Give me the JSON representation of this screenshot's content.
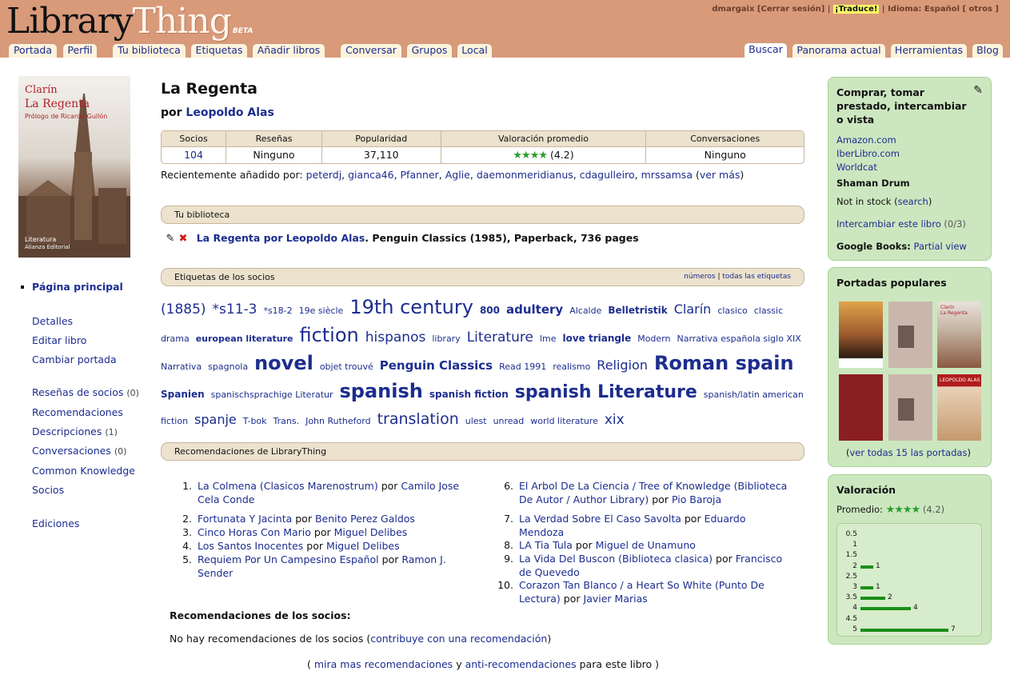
{
  "header": {
    "logo_part1": "Library",
    "logo_part2": "Thing",
    "logo_beta": "BETA",
    "user": "dmargaix",
    "logout": "[Cerrar sesión]",
    "translate": "¡Traduce!",
    "language": "Idioma: Español [ otros ]",
    "tabs_left": [
      "Portada",
      "Perfil",
      "Tu biblioteca",
      "Etiquetas",
      "Añadir libros",
      "Conversar",
      "Grupos",
      "Local"
    ],
    "tabs_right": [
      "Buscar",
      "Panorama actual",
      "Herramientas",
      "Blog"
    ]
  },
  "cover": {
    "author": "Clarín",
    "title": "La Regenta",
    "prologue": "Prólogo de Ricardo Gullón",
    "series": "Literatura",
    "publisher": "Alianza Editorial"
  },
  "leftnav": {
    "main": "Página principal",
    "details": "Detalles",
    "edit": "Editar libro",
    "change_cover": "Cambiar portada",
    "reviews": "Reseñas de socios",
    "reviews_count": "(0)",
    "recommendations": "Recomendaciones",
    "descriptions": "Descripciones",
    "descriptions_count": "(1)",
    "conversations": "Conversaciones",
    "conversations_count": "(0)",
    "common_knowledge": "Common Knowledge",
    "members": "Socios",
    "editions": "Ediciones"
  },
  "book": {
    "title": "La Regenta",
    "by": "por",
    "author": "Leopoldo Alas"
  },
  "stats": {
    "headers": [
      "Socios",
      "Reseñas",
      "Popularidad",
      "Valoración promedio",
      "Conversaciones"
    ],
    "members": "104",
    "reviews": "Ninguno",
    "popularity": "37,110",
    "rating_stars": "★★★★",
    "rating": "(4.2)",
    "conversations": "Ninguno"
  },
  "recent": {
    "label": "Recientemente añadido por:",
    "users": [
      "peterdj",
      "gianca46",
      "Pfanner",
      "Aglie",
      "daemonmeridianus",
      "cdagulleiro",
      "mrssamsa"
    ],
    "more": "ver más"
  },
  "mylibrary": {
    "heading": "Tu biblioteca",
    "entry_link": "La Regenta por Leopoldo Alas",
    "entry_rest": ". Penguin Classics (1985), Paperback, 736 pages"
  },
  "tags": {
    "heading": "Etiquetas de los socios",
    "link_numbers": "números",
    "link_all": "todas las etiquetas",
    "items": [
      {
        "t": "(1885)",
        "s": 17,
        "b": false
      },
      {
        "t": "*s11-3",
        "s": 17,
        "b": false
      },
      {
        "t": "*s18-2",
        "s": 11,
        "b": false
      },
      {
        "t": "19e siècle",
        "s": 11,
        "b": false
      },
      {
        "t": "19th century",
        "s": 24,
        "b": false
      },
      {
        "t": "800",
        "s": 12,
        "b": true
      },
      {
        "t": "adultery",
        "s": 15,
        "b": true
      },
      {
        "t": "Alcalde",
        "s": 11,
        "b": false
      },
      {
        "t": "Belletristik",
        "s": 12,
        "b": true
      },
      {
        "t": "Clarín",
        "s": 16,
        "b": false
      },
      {
        "t": "clasico",
        "s": 11,
        "b": false
      },
      {
        "t": "classic drama",
        "s": 11,
        "b": false
      },
      {
        "t": "european literature",
        "s": 11,
        "b": true
      },
      {
        "t": "fiction",
        "s": 24,
        "b": false
      },
      {
        "t": "hispanos",
        "s": 17,
        "b": false
      },
      {
        "t": "library",
        "s": 11,
        "b": false
      },
      {
        "t": "Literature",
        "s": 17,
        "b": false
      },
      {
        "t": "lme",
        "s": 11,
        "b": false
      },
      {
        "t": "love triangle",
        "s": 12,
        "b": true
      },
      {
        "t": "Modern",
        "s": 11,
        "b": false
      },
      {
        "t": "Narrativa española siglo XIX",
        "s": 11,
        "b": false
      },
      {
        "t": "Narrativa",
        "s": 11,
        "b": false
      },
      {
        "t": "spagnola",
        "s": 11,
        "b": false
      },
      {
        "t": "novel",
        "s": 24,
        "b": true
      },
      {
        "t": "objet trouvé",
        "s": 11,
        "b": false
      },
      {
        "t": "Penguin Classics",
        "s": 15,
        "b": true
      },
      {
        "t": "Read 1991",
        "s": 11,
        "b": false
      },
      {
        "t": "realismo",
        "s": 11,
        "b": false
      },
      {
        "t": "Religion",
        "s": 16,
        "b": false
      },
      {
        "t": "Roman spain",
        "s": 24,
        "b": true
      },
      {
        "t": "Spanien",
        "s": 12,
        "b": true
      },
      {
        "t": "spanischsprachige Literatur",
        "s": 11,
        "b": false
      },
      {
        "t": "spanish",
        "s": 24,
        "b": true
      },
      {
        "t": "spanish fiction",
        "s": 12,
        "b": true
      },
      {
        "t": "spanish Literature",
        "s": 22,
        "b": true
      },
      {
        "t": "spanish/latin american fiction",
        "s": 11,
        "b": false
      },
      {
        "t": "spanje",
        "s": 16,
        "b": false
      },
      {
        "t": "T-bok",
        "s": 11,
        "b": false
      },
      {
        "t": "Trans.",
        "s": 11,
        "b": false
      },
      {
        "t": "John Rutheford",
        "s": 11,
        "b": false
      },
      {
        "t": "translation",
        "s": 19,
        "b": false
      },
      {
        "t": "ulest",
        "s": 11,
        "b": false
      },
      {
        "t": "unread",
        "s": 11,
        "b": false
      },
      {
        "t": "world literature",
        "s": 11,
        "b": false
      },
      {
        "t": "xix",
        "s": 17,
        "b": false
      }
    ]
  },
  "recs": {
    "heading": "Recomendaciones de LibraryThing",
    "by": "por",
    "items": [
      {
        "n": "1.",
        "l1": "La Colmena (Clasicos Marenostrum)",
        "l2": "",
        "a1": "Camilo Jose",
        "a2": "Cela Conde"
      },
      {
        "n": "2.",
        "l1": "Fortunata Y Jacinta",
        "l2": "",
        "a1": "Benito Perez Galdos",
        "a2": ""
      },
      {
        "n": "3.",
        "l1": "Cinco Horas Con Mario",
        "l2": "",
        "a1": "Miguel Delibes",
        "a2": ""
      },
      {
        "n": "4.",
        "l1": "Los Santos Inocentes",
        "l2": "",
        "a1": "Miguel Delibes",
        "a2": ""
      },
      {
        "n": "5.",
        "l1": "Requiem Por Un Campesino Español",
        "l2": "",
        "a1": "Ramon J.",
        "a2": "Sender"
      },
      {
        "n": "6.",
        "l1": "El Arbol De La Ciencia / Tree of Knowledge (Biblioteca",
        "l2": "De Autor / Author Library)",
        "a1": "Pio Baroja",
        "a2": ""
      },
      {
        "n": "7.",
        "l1": "La Verdad Sobre El Caso Savolta",
        "l2": "",
        "a1": "Eduardo",
        "a2": "Mendoza"
      },
      {
        "n": "8.",
        "l1": "LA Tia Tula",
        "l2": "",
        "a1": "Miguel de Unamuno",
        "a2": ""
      },
      {
        "n": "9.",
        "l1": "La Vida Del Buscon (Biblioteca clasica)",
        "l2": "",
        "a1": "Francisco",
        "a2": "de Quevedo"
      },
      {
        "n": "10.",
        "l1": "Corazon Tan Blanco / a Heart So White (Punto De",
        "l2": "Lectura)",
        "a1": "Javier Marias",
        "a2": ""
      }
    ],
    "member_heading": "Recomendaciones de los socios:",
    "none_text": "No hay recomendaciones de los socios (",
    "contribute": "contribuye con una recomendación",
    "close_paren": ")",
    "more_open": "(",
    "more_link": "mira mas recomendaciones",
    "and": "y",
    "anti_link": "anti-recomendaciones",
    "more_tail": "para este libro )"
  },
  "buy": {
    "heading": "Comprar, tomar prestado, intercambiar o vista",
    "amazon": "Amazon.com",
    "iberlibro": "IberLibro.com",
    "worldcat": "Worldcat",
    "shaman": "Shaman Drum",
    "stock": "Not in stock (",
    "search": "search",
    "stock_close": ")",
    "swap": "Intercambiar este libro",
    "swap_count": "(0/3)",
    "google_label": "Google Books:",
    "google_link": "Partial view"
  },
  "covers": {
    "heading": "Portadas populares",
    "see_all": "ver todas 15 las portadas",
    "thumb_texts": [
      "",
      "",
      "Clarín",
      "La Regenta",
      "",
      "LEOPOLDO ALAS"
    ]
  },
  "rating": {
    "heading": "Valoración",
    "avg_label": "Promedio:",
    "stars": "★★★★",
    "avg": "(4.2)"
  },
  "chart_data": {
    "type": "bar",
    "categories": [
      "0.5",
      "1",
      "1.5",
      "2",
      "2.5",
      "3",
      "3.5",
      "4",
      "4.5",
      "5"
    ],
    "values": [
      0,
      0,
      0,
      1,
      0,
      1,
      2,
      4,
      0,
      7
    ],
    "title": "",
    "xlabel": "",
    "ylabel": ""
  },
  "colors": {
    "header": "#d99a7a",
    "link": "#1c2d8f",
    "section": "#ece2cd",
    "rightbox": "#cce7bf",
    "bars": "#1a8f1a",
    "stars": "#2d9c2d"
  }
}
